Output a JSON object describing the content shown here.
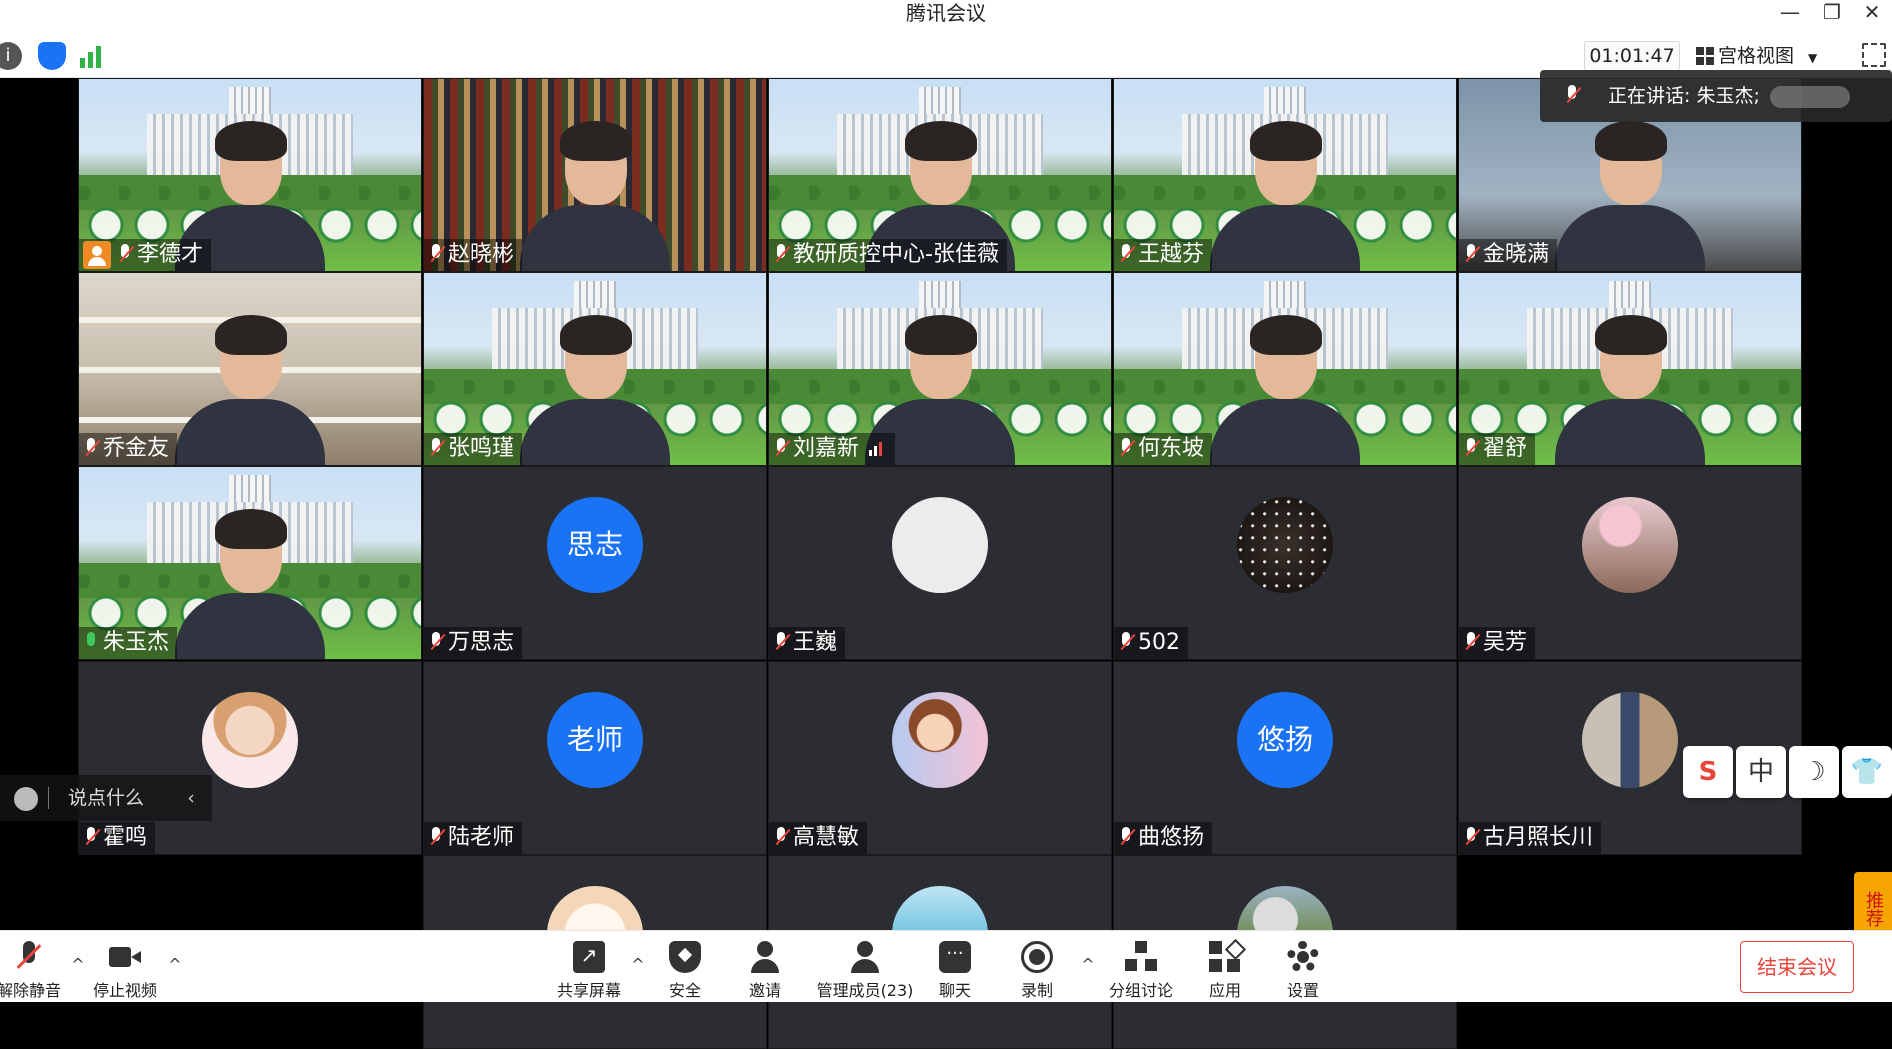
{
  "window": {
    "title": "腾讯会议"
  },
  "toolbar": {
    "timer": "01:01:47",
    "view_mode": "宫格视图"
  },
  "speaking": {
    "label": "正在讲话: 朱玉杰;"
  },
  "tiles": [
    {
      "name": "李德才",
      "type": "video",
      "host": true,
      "mic": "muted"
    },
    {
      "name": "赵晓彬",
      "type": "books",
      "mic": "muted"
    },
    {
      "name": "教研质控中心-张佳薇",
      "type": "video",
      "mic": "muted"
    },
    {
      "name": "王越芬",
      "type": "video",
      "mic": "muted"
    },
    {
      "name": "金晓满",
      "type": "wall",
      "mic": "muted"
    },
    {
      "name": "乔金友",
      "type": "room",
      "mic": "muted"
    },
    {
      "name": "张鸣瑾",
      "type": "video",
      "mic": "muted"
    },
    {
      "name": "刘嘉新",
      "type": "video",
      "mic": "muted",
      "signal": true
    },
    {
      "name": "何东坡",
      "type": "video",
      "mic": "muted"
    },
    {
      "name": "翟舒",
      "type": "video",
      "mic": "muted"
    },
    {
      "name": "朱玉杰",
      "type": "video",
      "mic": "active"
    },
    {
      "name": "万思志",
      "type": "avatar",
      "avatar": "text",
      "avatar_text": "思志",
      "mic": "muted"
    },
    {
      "name": "王巍",
      "type": "avatar",
      "avatar": "blank",
      "mic": "muted"
    },
    {
      "name": "502",
      "type": "avatar",
      "avatar": "stars",
      "mic": "muted"
    },
    {
      "name": "吴芳",
      "type": "avatar",
      "avatar": "flowers",
      "mic": "muted"
    },
    {
      "name": "霍鸣",
      "type": "avatar",
      "avatar": "lady",
      "mic": "muted"
    },
    {
      "name": "陆老师",
      "type": "avatar",
      "avatar": "text",
      "avatar_text": "老师",
      "mic": "muted"
    },
    {
      "name": "高慧敏",
      "type": "avatar",
      "avatar": "cartoon",
      "mic": "muted"
    },
    {
      "name": "曲悠扬",
      "type": "avatar",
      "avatar": "text",
      "avatar_text": "悠扬",
      "mic": "muted"
    },
    {
      "name": "古月照长川",
      "type": "avatar",
      "avatar": "horse",
      "mic": "muted"
    },
    {
      "name": "",
      "type": "avatar",
      "avatar": "cake",
      "mic": "none"
    },
    {
      "name": "",
      "type": "avatar",
      "avatar": "sea",
      "mic": "none"
    },
    {
      "name": "",
      "type": "avatar",
      "avatar": "train",
      "mic": "none"
    }
  ],
  "chat": {
    "placeholder": "说点什么"
  },
  "ime": {
    "keys": [
      "S",
      "中",
      "☽",
      "👕"
    ]
  },
  "recommend_label": "推荐",
  "bottombar": {
    "unmute": "解除静音",
    "stop_video": "停止视频",
    "share_screen": "共享屏幕",
    "security": "安全",
    "invite": "邀请",
    "manage_members": "管理成员(23)",
    "chat": "聊天",
    "record": "录制",
    "breakout": "分组讨论",
    "apps": "应用",
    "settings": "设置",
    "end_meeting": "结束会议"
  }
}
